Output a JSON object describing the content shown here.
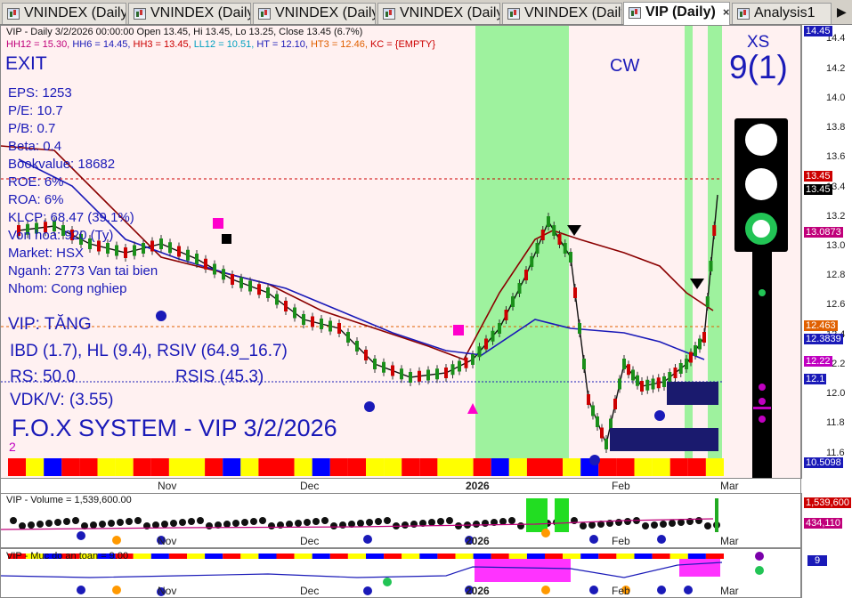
{
  "tabs": [
    {
      "label": "VNINDEX (Daily)",
      "active": false
    },
    {
      "label": "VNINDEX (Daily)",
      "active": false
    },
    {
      "label": "VNINDEX (Daily)",
      "active": false
    },
    {
      "label": "VNINDEX (Daily)",
      "active": false
    },
    {
      "label": "VNINDEX (Daily)",
      "active": false
    },
    {
      "label": "VIP (Daily)",
      "active": true
    },
    {
      "label": "Analysis1",
      "active": false
    }
  ],
  "tab_close": "×",
  "tab_arrow": "▶",
  "chart_header": {
    "ohlc": "VIP - Daily 3/2/2026 00:00:00 Open 13.45, Hi 13.45, Lo 13.25, Close 13.45 (6.7%)",
    "levels": [
      {
        "text": "HH12 = 15.30, ",
        "color": "#c0007a"
      },
      {
        "text": "HH6 = 14.45, ",
        "color": "#1a1ab8"
      },
      {
        "text": "HH3 = 13.45, ",
        "color": "#cc0000"
      },
      {
        "text": "LL12 = 10.51, ",
        "color": "#00a0c0"
      },
      {
        "text": "HT = 12.10, ",
        "color": "#1a1ab8"
      },
      {
        "text": "HT3 = 12.46, ",
        "color": "#e06000"
      },
      {
        "text": "KC = {EMPTY}",
        "color": "#cc0000"
      }
    ]
  },
  "exit_label": "EXIT",
  "fundamentals": [
    "EPS: 1253",
    "P/E: 10.7",
    "P/B: 0.7",
    "Beta: 0.4",
    "Bookvalue: 18682",
    "ROE: 6%",
    "ROA: 6%",
    "KLCP: 68.47 (39.1%)",
    "Von hoa: 920 (Ty)",
    "Market: HSX",
    "Nganh: 2773 Van tai bien",
    "Nhom: Cong nghiep"
  ],
  "signals": {
    "status": "VIP: TĂNG",
    "ibd": "IBD (1.7), HL (9.4), RSIV (64.9_16.7)",
    "rs": "RS: 50.0",
    "rsis": "RSIS (45.3)",
    "vdkv": "VDK/V:  (3.55)",
    "system": "F.O.X SYSTEM - VIP 3/2/2026",
    "bottom_num": "2"
  },
  "cw_label": "CW",
  "xs_label": "XS",
  "xs_value": "9(1)",
  "price_axis": [
    "14.4",
    "14.2",
    "14.0",
    "13.8",
    "13.6",
    "13.4",
    "13.2",
    "13.0",
    "12.8",
    "12.6",
    "12.4",
    "12.2",
    "12.0",
    "11.8",
    "11.6"
  ],
  "price_labels": [
    {
      "text": "14.45",
      "bg": "#1a1ab8",
      "v": 14.45
    },
    {
      "text": "13.45",
      "bg": "#cc0000",
      "v": 13.47
    },
    {
      "text": "13.45",
      "bg": "#000000",
      "v": 13.38
    },
    {
      "text": "13.0873",
      "bg": "#c0007a",
      "v": 13.09
    },
    {
      "text": "12.463",
      "bg": "#e06000",
      "v": 12.46
    },
    {
      "text": "12.3839",
      "bg": "#1a1ab8",
      "v": 12.37
    },
    {
      "text": "12.22",
      "bg": "#c000c0",
      "v": 12.22
    },
    {
      "text": "12.1",
      "bg": "#1a1ab8",
      "v": 12.1
    },
    {
      "text": "10.5098",
      "bg": "#1a1ab8",
      "v": 11.53
    }
  ],
  "dates": [
    "Nov",
    "Dec",
    "2026",
    "Feb",
    "Mar"
  ],
  "volume": {
    "header": "VIP - Volume = 1,539,600.00",
    "labels": [
      {
        "text": "1,539,600",
        "bg": "#cc0000"
      },
      {
        "text": "434,110",
        "bg": "#c0007a"
      }
    ]
  },
  "safety": {
    "header": "VIP - Muc do an toan = 9.00",
    "label": "9"
  }
}
